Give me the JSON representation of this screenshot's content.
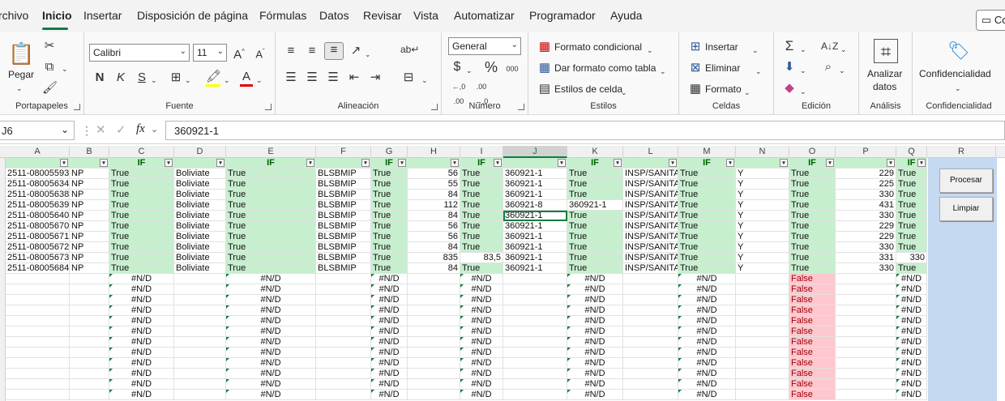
{
  "menu": {
    "tabs": [
      "rchivo",
      "Inicio",
      "Insertar",
      "Disposición de página",
      "Fórmulas",
      "Datos",
      "Revisar",
      "Vista",
      "Automatizar",
      "Programador",
      "Ayuda"
    ],
    "active_tab": "Inicio",
    "comments_button": "Co"
  },
  "ribbon": {
    "clipboard": {
      "label": "Portapapeles",
      "paste": "Pegar"
    },
    "font": {
      "label": "Fuente",
      "font_name": "Calibri",
      "font_size": "11",
      "bold": "N",
      "italic": "K",
      "underline": "S"
    },
    "alignment": {
      "label": "Alineación"
    },
    "number": {
      "label": "Número",
      "format": "General",
      "currency": "$",
      "percent": "%",
      "thousands": "000"
    },
    "styles": {
      "label": "Estilos",
      "conditional": "Formato condicional",
      "as_table": "Dar formato como tabla",
      "cell_styles": "Estilos de celda"
    },
    "cells": {
      "label": "Celdas",
      "insert": "Insertar",
      "delete": "Eliminar",
      "format": "Formato"
    },
    "editing": {
      "label": "Edición"
    },
    "analysis": {
      "label": "Análisis",
      "analyze": "Analizar",
      "analyze2": "datos"
    },
    "sensitivity": {
      "label": "Confidencialidad",
      "button": "Confidencialidad"
    }
  },
  "formula_bar": {
    "name_box": "J6",
    "fx": "fx",
    "value": "360921-1"
  },
  "grid": {
    "columns": [
      "A",
      "B",
      "C",
      "D",
      "E",
      "F",
      "G",
      "H",
      "I",
      "J",
      "K",
      "L",
      "M",
      "N",
      "O",
      "P",
      "Q",
      "R"
    ],
    "selected_column": "J",
    "header_row": [
      "",
      "",
      "IF",
      "",
      "IF",
      "",
      "IF",
      "",
      "IF",
      "",
      "IF",
      "",
      "IF",
      "",
      "IF",
      "",
      "IF"
    ],
    "rows": [
      [
        "2511-08005593",
        "NP",
        "True",
        "Boliviate",
        "True",
        "BLSBMIP",
        "True",
        "56",
        "True",
        "360921-1",
        "True",
        "INSP/SANITAR",
        "True",
        "Y",
        "True",
        "229",
        "True"
      ],
      [
        "2511-08005634",
        "NP",
        "True",
        "Boliviate",
        "True",
        "BLSBMIP",
        "True",
        "55",
        "True",
        "360921-1",
        "True",
        "INSP/SANITAR",
        "True",
        "Y",
        "True",
        "225",
        "True"
      ],
      [
        "2511-08005638",
        "NP",
        "True",
        "Boliviate",
        "True",
        "BLSBMIP",
        "True",
        "84",
        "True",
        "360921-1",
        "True",
        "INSP/SANITAR",
        "True",
        "Y",
        "True",
        "330",
        "True"
      ],
      [
        "2511-08005639",
        "NP",
        "True",
        "Boliviate",
        "True",
        "BLSBMIP",
        "True",
        "112",
        "True",
        "360921-8",
        "360921-1",
        "INSP/SANITAR",
        "True",
        "Y",
        "True",
        "431",
        "True"
      ],
      [
        "2511-08005640",
        "NP",
        "True",
        "Boliviate",
        "True",
        "BLSBMIP",
        "True",
        "84",
        "True",
        "360921-1",
        "True",
        "INSP/SANITAR",
        "True",
        "Y",
        "True",
        "330",
        "True"
      ],
      [
        "2511-08005670",
        "NP",
        "True",
        "Boliviate",
        "True",
        "BLSBMIP",
        "True",
        "56",
        "True",
        "360921-1",
        "True",
        "INSP/SANITAR",
        "True",
        "Y",
        "True",
        "229",
        "True"
      ],
      [
        "2511-08005671",
        "NP",
        "True",
        "Boliviate",
        "True",
        "BLSBMIP",
        "True",
        "56",
        "True",
        "360921-1",
        "True",
        "INSP/SANITAR",
        "True",
        "Y",
        "True",
        "229",
        "True"
      ],
      [
        "2511-08005672",
        "NP",
        "True",
        "Boliviate",
        "True",
        "BLSBMIP",
        "True",
        "84",
        "True",
        "360921-1",
        "True",
        "INSP/SANITAR",
        "True",
        "Y",
        "True",
        "330",
        "True"
      ],
      [
        "2511-08005673",
        "NP",
        "True",
        "Boliviate",
        "True",
        "BLSBMIP",
        "True",
        "835",
        "83,5",
        "360921-1",
        "True",
        "INSP/SANITAR",
        "True",
        "Y",
        "True",
        "331",
        "330"
      ],
      [
        "2511-08005684",
        "NP",
        "True",
        "Boliviate",
        "True",
        "BLSBMIP",
        "True",
        "84",
        "True",
        "360921-1",
        "True",
        "INSP/SANITAR",
        "True",
        "Y",
        "True",
        "330",
        "True"
      ]
    ],
    "error_value": "#N/D",
    "false_value": "False",
    "error_row_count": 12
  },
  "panel": {
    "process_button": "Procesar",
    "clear_button": "Limpiar"
  },
  "colors": {
    "accent": "#107c41",
    "ok_fill": "#c6efce",
    "bad_fill": "#ffc7ce",
    "panel": "#c5d9f1"
  }
}
